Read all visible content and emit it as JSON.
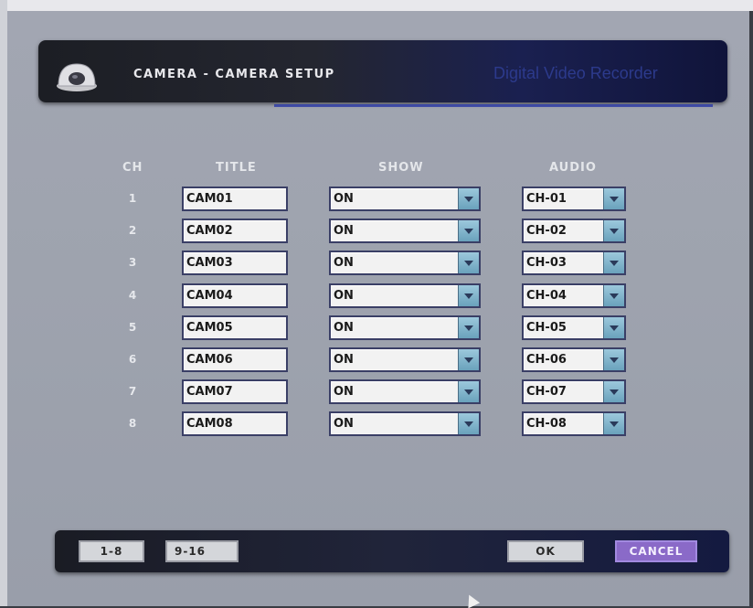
{
  "header": {
    "title": "CAMERA - CAMERA SETUP",
    "brand": "Digital Video Recorder",
    "icon": "dome-camera-icon"
  },
  "columns": {
    "ch": "CH",
    "title": "TITLE",
    "show": "SHOW",
    "audio": "AUDIO"
  },
  "rows": [
    {
      "ch": "1",
      "title": "CAM01",
      "show": "ON",
      "audio": "CH-01"
    },
    {
      "ch": "2",
      "title": "CAM02",
      "show": "ON",
      "audio": "CH-02"
    },
    {
      "ch": "3",
      "title": "CAM03",
      "show": "ON",
      "audio": "CH-03"
    },
    {
      "ch": "4",
      "title": "CAM04",
      "show": "ON",
      "audio": "CH-04"
    },
    {
      "ch": "5",
      "title": "CAM05",
      "show": "ON",
      "audio": "CH-05"
    },
    {
      "ch": "6",
      "title": "CAM06",
      "show": "ON",
      "audio": "CH-06"
    },
    {
      "ch": "7",
      "title": "CAM07",
      "show": "ON",
      "audio": "CH-07"
    },
    {
      "ch": "8",
      "title": "CAM08",
      "show": "ON",
      "audio": "CH-08"
    }
  ],
  "footer": {
    "page1_label": "1-8",
    "page2_label": "9-16",
    "ok_label": "OK",
    "cancel_label": "CANCEL"
  },
  "colors": {
    "accent": "#2c3a8c",
    "cancel": "#8a6ac8",
    "dropdown": "#6aa2bc"
  }
}
